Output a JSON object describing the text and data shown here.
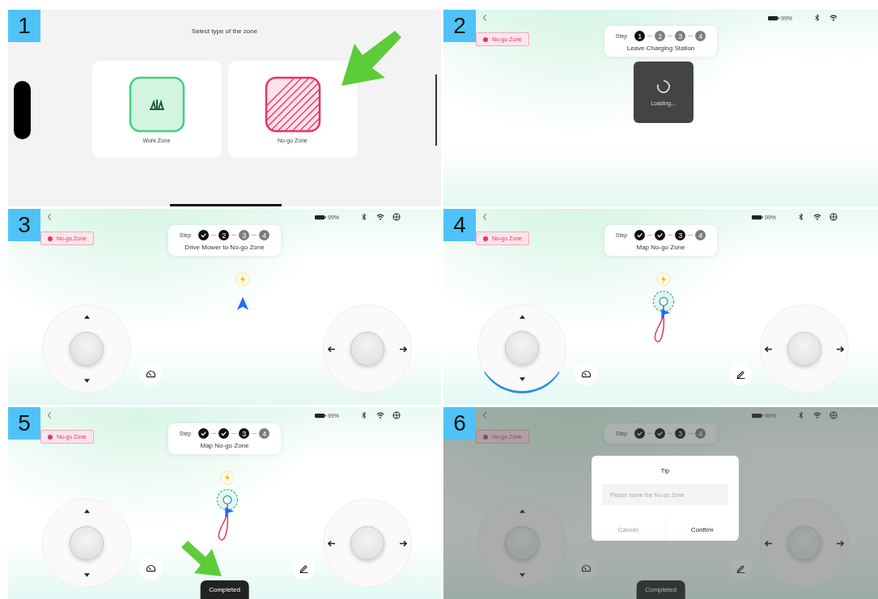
{
  "panels": [
    {
      "number": "1",
      "kind": "zone_select",
      "pointer": {
        "kind": "down-left"
      },
      "title": "Select type of the zone",
      "options": [
        {
          "kind": "work",
          "label": "Work Zone"
        },
        {
          "kind": "nogo",
          "label": "No-go Zone"
        }
      ]
    },
    {
      "number": "2",
      "kind": "loading",
      "battery": "99%",
      "status_extra": false,
      "zone_tag": "No-go Zone",
      "step_prefix": "Step",
      "steps": [
        {
          "done": false,
          "current": true,
          "number": "1"
        },
        {
          "done": false,
          "current": false,
          "number": "2"
        },
        {
          "done": false,
          "current": false,
          "number": "3"
        },
        {
          "done": false,
          "current": false,
          "number": "4"
        }
      ],
      "caption": "Leave Charging Station",
      "loading": "Loading..."
    },
    {
      "number": "3",
      "kind": "drive",
      "battery": "99%",
      "status_extra": true,
      "zone_tag": "No-go Zone",
      "step_prefix": "Step",
      "steps": [
        {
          "done": true
        },
        {
          "done": false,
          "current": true,
          "number": "2"
        },
        {
          "done": false,
          "current": false,
          "number": "3"
        },
        {
          "done": false,
          "current": false,
          "number": "4"
        }
      ],
      "caption": "Drive Mower to No-go Zone",
      "left_stick_active": false,
      "edit": false
    },
    {
      "number": "4",
      "kind": "trace",
      "battery": "99%",
      "status_extra": true,
      "zone_tag": "No-go Zone",
      "step_prefix": "Step",
      "steps": [
        {
          "done": true
        },
        {
          "done": true
        },
        {
          "done": false,
          "current": true,
          "number": "3"
        },
        {
          "done": false,
          "current": false,
          "number": "4"
        }
      ],
      "caption": "Map No-go Zone",
      "left_stick_active": true,
      "edit": true
    },
    {
      "number": "5",
      "kind": "trace",
      "pointer": {
        "kind": "down-right"
      },
      "battery": "99%",
      "status_extra": true,
      "zone_tag": "No-go Zone",
      "step_prefix": "Step",
      "steps": [
        {
          "done": true
        },
        {
          "done": true
        },
        {
          "done": false,
          "current": true,
          "number": "3"
        },
        {
          "done": false,
          "current": false,
          "number": "4"
        }
      ],
      "caption": "Map No-go Zone",
      "left_stick_active": false,
      "edit": true,
      "completed": "Completed"
    },
    {
      "number": "6",
      "kind": "naming",
      "battery": "99%",
      "status_extra": true,
      "zone_tag": "No-go Zone",
      "step_prefix": "Step",
      "steps": [
        {
          "done": true
        },
        {
          "done": true
        },
        {
          "done": false,
          "current": true,
          "number": "3"
        },
        {
          "done": false,
          "current": false,
          "number": "4"
        }
      ],
      "left_stick_active": false,
      "edit": true,
      "completed": "Completed",
      "dialog": {
        "title": "Tip",
        "placeholder": "Please name the No-go Zone",
        "buttons": [
          "Cancel",
          "Confirm"
        ]
      }
    }
  ]
}
